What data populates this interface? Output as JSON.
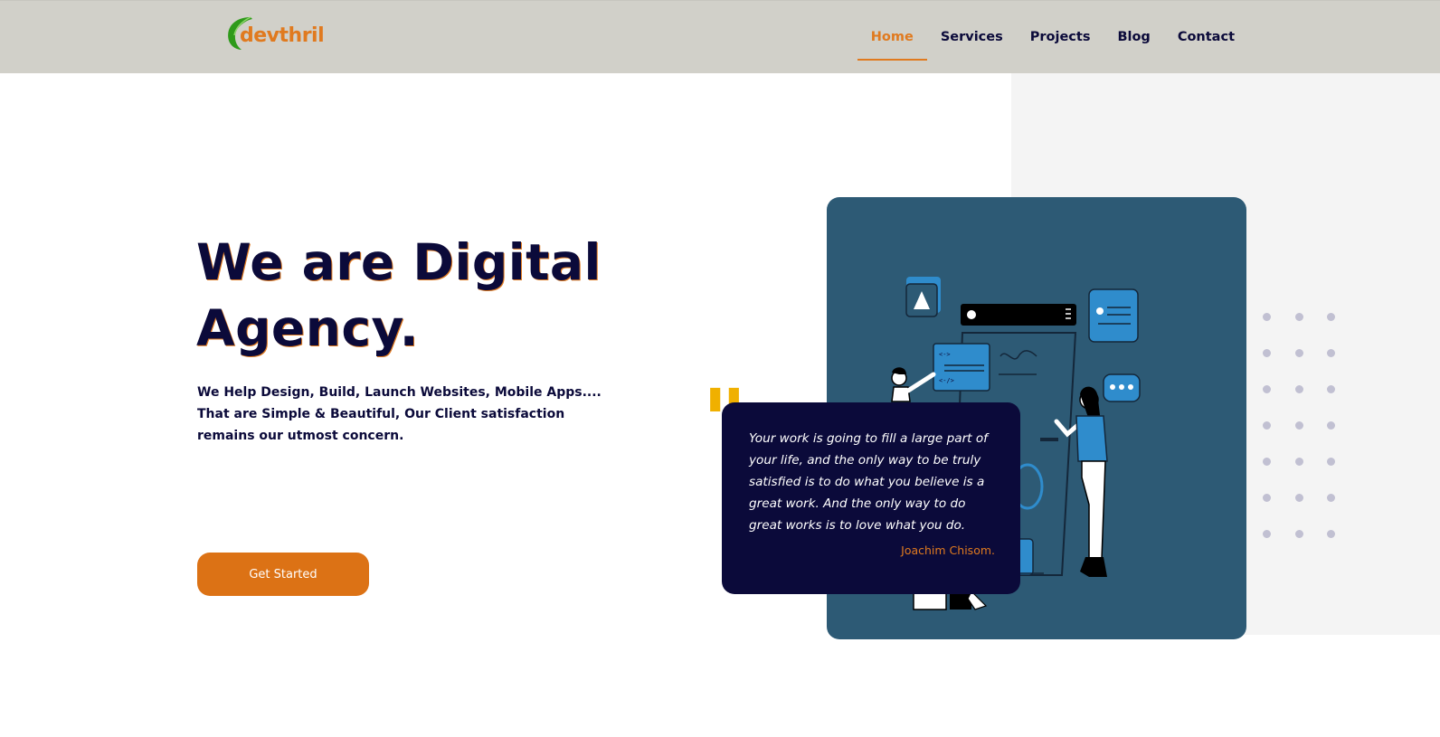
{
  "brand": {
    "logo_text": "devthril",
    "accent_color": "#e07a1f",
    "leaf_color": "#2e9a1a"
  },
  "nav": {
    "items": [
      {
        "label": "Home",
        "active": true
      },
      {
        "label": "Services",
        "active": false
      },
      {
        "label": "Projects",
        "active": false
      },
      {
        "label": "Blog",
        "active": false
      },
      {
        "label": "Contact",
        "active": false
      }
    ]
  },
  "hero": {
    "title_line1": "We are Digital",
    "title_line2": "Agency.",
    "subtitle": "We Help Design, Build, Launch Websites, Mobile Apps.... That are Simple & Beautiful, Our Client satisfaction remains our utmost concern.",
    "cta_label": "Get Started"
  },
  "quote": {
    "mark": "\"",
    "text": "Your work is going to fill a large part of your life, and the only way to be truly satisfied is to do what you believe is a great work. And the only way to do great works is to love what you do.",
    "author": "Joachim Chisom."
  },
  "colors": {
    "navy": "#0b0a3a",
    "orange": "#dc7215",
    "card_blue": "#2d5a75",
    "nav_bg": "#d1d0c9",
    "dot": "#c1c0d2",
    "quote_mark": "#f0b000"
  }
}
